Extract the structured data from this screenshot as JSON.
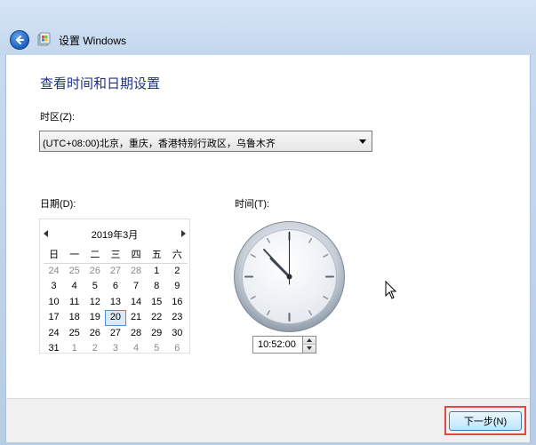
{
  "window": {
    "title": "设置 Windows"
  },
  "page": {
    "heading": "查看时间和日期设置",
    "timezone_label": "时区(Z):",
    "timezone_value": "(UTC+08:00)北京，重庆，香港特别行政区，乌鲁木齐"
  },
  "date_section": {
    "label": "日期(D):",
    "month_title": "2019年3月",
    "weekdays": [
      "日",
      "一",
      "二",
      "三",
      "四",
      "五",
      "六"
    ],
    "weeks": [
      [
        "24",
        "25",
        "26",
        "27",
        "28",
        "1",
        "2"
      ],
      [
        "3",
        "4",
        "5",
        "6",
        "7",
        "8",
        "9"
      ],
      [
        "10",
        "11",
        "12",
        "13",
        "14",
        "15",
        "16"
      ],
      [
        "17",
        "18",
        "19",
        "20",
        "21",
        "22",
        "23"
      ],
      [
        "24",
        "25",
        "26",
        "27",
        "28",
        "29",
        "30"
      ],
      [
        "31",
        "1",
        "2",
        "3",
        "4",
        "5",
        "6"
      ]
    ],
    "selected_day": "20"
  },
  "time_section": {
    "label": "时间(T):",
    "value": "10:52:00"
  },
  "footer": {
    "next_label": "下一步(N)"
  },
  "icons": {
    "back": "back-arrow-icon",
    "app": "windows-setup-icon",
    "cursor": "mouse-pointer-icon"
  }
}
